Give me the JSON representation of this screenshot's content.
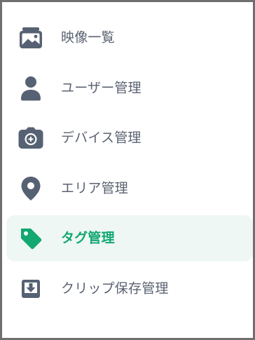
{
  "menu": {
    "items": [
      {
        "label": "映像一覧",
        "icon": "images-icon",
        "active": false
      },
      {
        "label": "ユーザー管理",
        "icon": "user-icon",
        "active": false
      },
      {
        "label": "デバイス管理",
        "icon": "camera-icon",
        "active": false
      },
      {
        "label": "エリア管理",
        "icon": "location-pin-icon",
        "active": false
      },
      {
        "label": "タグ管理",
        "icon": "tag-icon",
        "active": true
      },
      {
        "label": "クリップ保存管理",
        "icon": "download-box-icon",
        "active": false
      }
    ]
  },
  "colors": {
    "icon": "#566273",
    "text": "#5a6270",
    "active_text": "#13a772",
    "active_icon": "#13a772",
    "active_bg": "#eef7f4",
    "frame_border": "#6f6f6f"
  }
}
